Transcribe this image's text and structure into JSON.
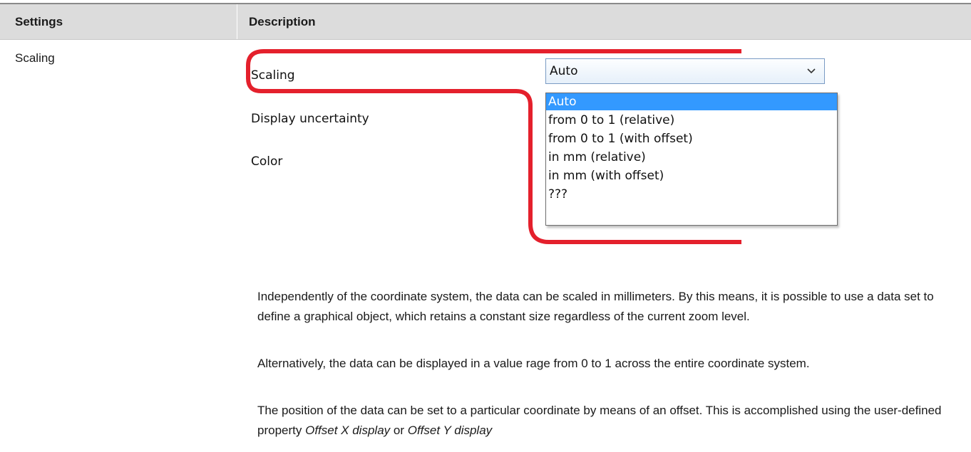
{
  "table": {
    "headers": {
      "settings": "Settings",
      "description": "Description"
    },
    "row": {
      "label": "Scaling"
    }
  },
  "screenshot": {
    "properties": [
      "Scaling",
      "Display uncertainty",
      "Color"
    ],
    "combo": {
      "value": "Auto"
    },
    "dropdown": {
      "options": [
        "Auto",
        "from 0 to 1  (relative)",
        "from 0 to 1  (with offset)",
        "in mm  (relative)",
        "in mm  (with offset)",
        "???"
      ],
      "selected": "Auto"
    },
    "highlight_color": "#e4202c",
    "selection_color": "#3399ff"
  },
  "description": {
    "p1": "Independently of the coordinate system, the data can be scaled in millimeters. By this means, it is possible to use a data set to define a graphical object, which retains a constant size regardless of the current zoom level.",
    "p2": "Alternatively, the data can be displayed in a value rage from 0 to 1 across the entire coordinate system.",
    "p3_pre": "The position of the data can be set to a particular coordinate by means of an offset. This is accomplished using the user-defined property ",
    "p3_em1": "Offset X display",
    "p3_mid": " or ",
    "p3_em2": "Offset Y display"
  }
}
